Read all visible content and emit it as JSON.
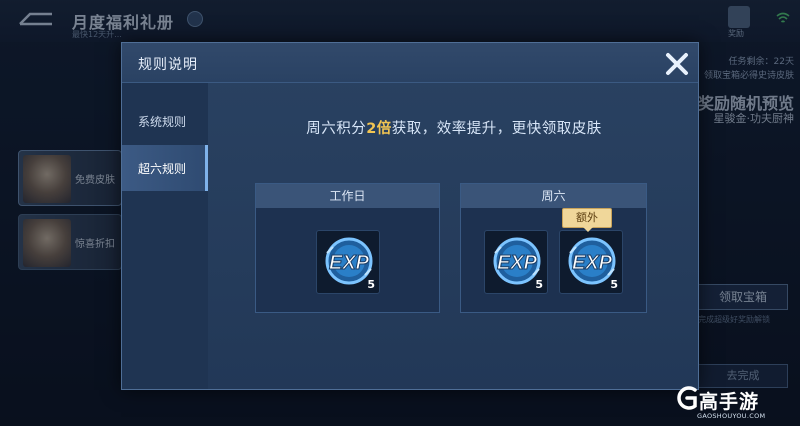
{
  "background": {
    "title": "月度福利礼册",
    "subtitle": "最快12天升...",
    "reward_label": "奖励",
    "side_cards": [
      {
        "label": "免费皮肤"
      },
      {
        "label": "惊喜折扣"
      }
    ],
    "right_lines": [
      "任务剩余：22天",
      "领取宝箱必得史诗皮肤"
    ],
    "right_big": "奖励随机预览",
    "right_mid": "星骏金·功夫厨神",
    "box_button": "领取宝箱",
    "box_note": "完成超级好奖励解锁",
    "go_button": "去完成"
  },
  "modal": {
    "title": "规则说明",
    "tabs": [
      {
        "label": "系统规则",
        "active": false
      },
      {
        "label": "超六规则",
        "active": true
      }
    ],
    "headline": {
      "before": "周六积分",
      "highlight": "2倍",
      "after": "获取，效率提升，更快领取皮肤"
    },
    "workday": {
      "header": "工作日",
      "items": [
        {
          "icon": "exp-icon",
          "count": "5"
        }
      ]
    },
    "saturday": {
      "header": "周六",
      "items": [
        {
          "icon": "exp-icon",
          "count": "5"
        },
        {
          "icon": "exp-icon",
          "count": "5",
          "tag": "额外"
        }
      ]
    }
  },
  "watermark": {
    "text": "高手游",
    "url": "GAOSHOUYOU.COM"
  },
  "colors": {
    "highlight": "#f2c552",
    "modal_bg": "#223857",
    "tag_bg": "#f0d79a"
  }
}
